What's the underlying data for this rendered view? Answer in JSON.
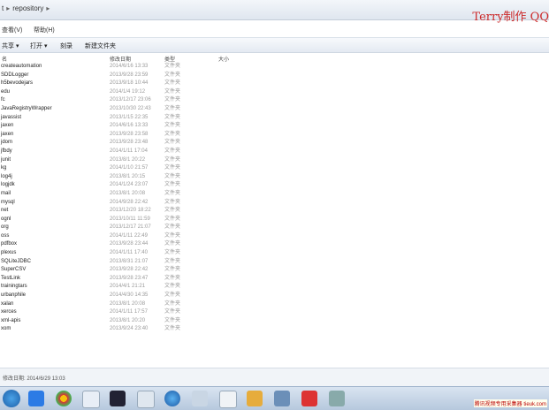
{
  "address": {
    "parts": [
      "t",
      "repository"
    ]
  },
  "watermark": "Terry制作 QQ",
  "menu": {
    "items": [
      "查看(V)",
      "帮助(H)"
    ]
  },
  "toolbar": {
    "items": [
      "共享 ▾",
      "打开 ▾",
      "刻录",
      "新建文件夹"
    ]
  },
  "columns": {
    "name": "名",
    "date": "修改日期",
    "type": "类型",
    "size": "大小"
  },
  "files": [
    {
      "name": "createautomation",
      "date": "2014/6/16 13:33",
      "type": "文件夹"
    },
    {
      "name": "SDDLogger",
      "date": "2013/9/28 23:59",
      "type": "文件夹"
    },
    {
      "name": "h5bevodejars",
      "date": "2013/9/18 10:44",
      "type": "文件夹"
    },
    {
      "name": "edu",
      "date": "2014/1/4 19:12",
      "type": "文件夹"
    },
    {
      "name": "fc",
      "date": "2013/12/17 23:06",
      "type": "文件夹"
    },
    {
      "name": "JavaRegistryWrapper",
      "date": "2013/10/30 22:43",
      "type": "文件夹"
    },
    {
      "name": "javassist",
      "date": "2013/1/15 22:35",
      "type": "文件夹"
    },
    {
      "name": "jaxen",
      "date": "2014/6/16 13:33",
      "type": "文件夹"
    },
    {
      "name": "jaxen",
      "date": "2013/9/28 23:58",
      "type": "文件夹"
    },
    {
      "name": "jdom",
      "date": "2013/9/28 23:48",
      "type": "文件夹"
    },
    {
      "name": "jfbdy",
      "date": "2014/1/11 17:04",
      "type": "文件夹"
    },
    {
      "name": "junit",
      "date": "2013/8/1 20:22",
      "type": "文件夹"
    },
    {
      "name": "kg",
      "date": "2014/1/10 21:57",
      "type": "文件夹"
    },
    {
      "name": "log4j",
      "date": "2013/8/1 20:15",
      "type": "文件夹"
    },
    {
      "name": "logjdk",
      "date": "2014/1/24 23:07",
      "type": "文件夹"
    },
    {
      "name": "mail",
      "date": "2013/8/1 20:08",
      "type": "文件夹"
    },
    {
      "name": "mysql",
      "date": "2014/9/28 22:42",
      "type": "文件夹"
    },
    {
      "name": "net",
      "date": "2013/12/20 18:22",
      "type": "文件夹"
    },
    {
      "name": "ognl",
      "date": "2013/10/11 11:59",
      "type": "文件夹"
    },
    {
      "name": "org",
      "date": "2013/12/17 21:07",
      "type": "文件夹"
    },
    {
      "name": "oss",
      "date": "2014/1/11 22:49",
      "type": "文件夹"
    },
    {
      "name": "pdfbox",
      "date": "2013/9/28 23:44",
      "type": "文件夹"
    },
    {
      "name": "plexus",
      "date": "2014/1/11 17:40",
      "type": "文件夹"
    },
    {
      "name": "SQLiteJDBC",
      "date": "2013/8/31 21:07",
      "type": "文件夹"
    },
    {
      "name": "SuperCSV",
      "date": "2013/9/28 22:42",
      "type": "文件夹"
    },
    {
      "name": "TestLink",
      "date": "2013/9/28 23:47",
      "type": "文件夹"
    },
    {
      "name": "trainingtars",
      "date": "2014/4/1 21:21",
      "type": "文件夹"
    },
    {
      "name": "urbanphile",
      "date": "2014/4/30 14:35",
      "type": "文件夹"
    },
    {
      "name": "xalan",
      "date": "2013/8/1 20:08",
      "type": "文件夹"
    },
    {
      "name": "xerces",
      "date": "2014/1/11 17:57",
      "type": "文件夹"
    },
    {
      "name": "xml-apis",
      "date": "2013/8/1 20:20",
      "type": "文件夹"
    },
    {
      "name": "xom",
      "date": "2013/9/24 23:40",
      "type": "文件夹"
    }
  ],
  "status": "修改日期: 2014/6/29 13:03",
  "tray": "腾讯视频专用采集器 tieuk.com"
}
